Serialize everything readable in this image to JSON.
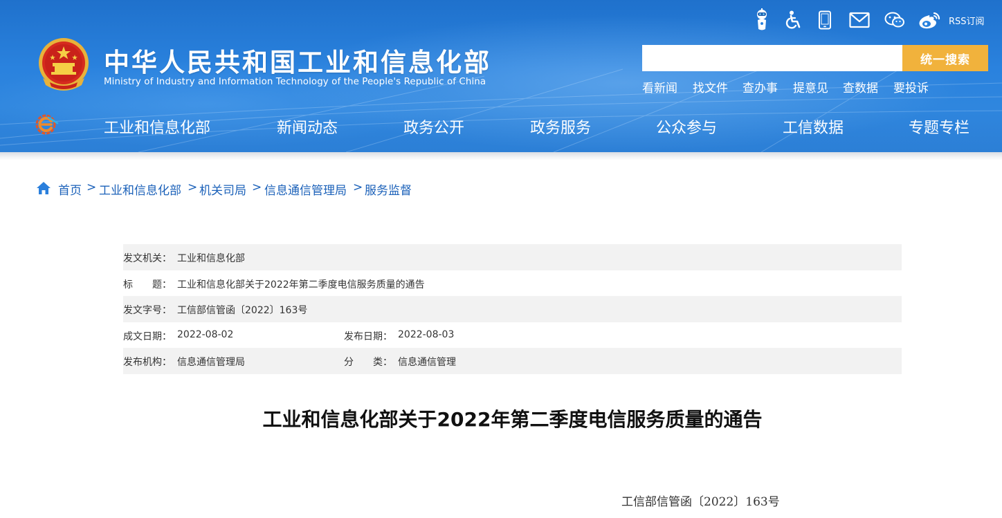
{
  "header": {
    "title": "中华人民共和国工业和信息化部",
    "subtitle": "Ministry of Industry and Information Technology of the People's Republic of China",
    "rss_label": "RSS订阅",
    "tool_icons": [
      "robot-assistant-icon",
      "accessibility-icon",
      "mobile-icon",
      "mail-icon",
      "wechat-icon",
      "weibo-icon"
    ]
  },
  "search": {
    "placeholder": "",
    "button_label": "统一搜索",
    "quick_links": [
      "看新闻",
      "找文件",
      "查办事",
      "提意见",
      "查数据",
      "要投诉"
    ]
  },
  "nav": {
    "items": [
      "工业和信息化部",
      "新闻动态",
      "政务公开",
      "政务服务",
      "公众参与",
      "工信数据",
      "专题专栏"
    ]
  },
  "breadcrumb": {
    "items": [
      "首页",
      "工业和信息化部",
      "机关司局",
      "信息通信管理局",
      "服务监督"
    ],
    "separator": ">"
  },
  "meta": {
    "issuer_label": "发文机关：",
    "issuer": "工业和信息化部",
    "title_label": "标　　题：",
    "title": "工业和信息化部关于2022年第二季度电信服务质量的通告",
    "doc_no_label": "发文字号：",
    "doc_no": "工信部信管函〔2022〕163号",
    "created_label": "成文日期：",
    "created": "2022-08-02",
    "published_label": "发布日期：",
    "published": "2022-08-03",
    "org_label": "发布机构：",
    "org": "信息通信管理局",
    "category_label": "分　　类：",
    "category": "信息通信管理"
  },
  "article": {
    "title": "工业和信息化部关于2022年第二季度电信服务质量的通告",
    "doc_number": "工信部信管函〔2022〕163号"
  },
  "colors": {
    "header_blue": "#2a82de",
    "search_button": "#f1b23c",
    "link_blue": "#1b61b9",
    "row_shade": "#f2f2f2"
  }
}
